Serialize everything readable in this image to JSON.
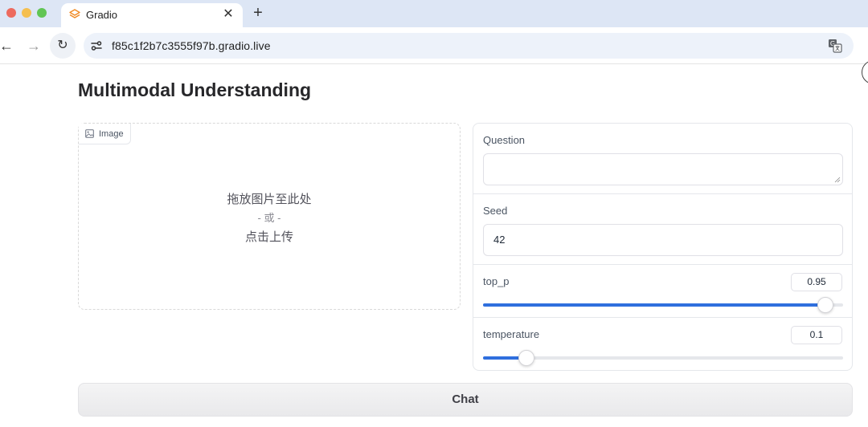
{
  "browser": {
    "tab_title": "Gradio",
    "url": "f85c1f2b7c3555f97b.gradio.live",
    "close_glyph": "✕",
    "new_tab_glyph": "+",
    "back_glyph": "←",
    "forward_glyph": "→",
    "reload_glyph": "↻"
  },
  "page": {
    "title": "Multimodal Understanding"
  },
  "image_upload": {
    "label": "Image",
    "drop_text": "拖放图片至此处",
    "or_text": "- 或 -",
    "click_text": "点击上传"
  },
  "form": {
    "question": {
      "label": "Question",
      "value": ""
    },
    "seed": {
      "label": "Seed",
      "value": "42"
    },
    "top_p": {
      "label": "top_p",
      "value": "0.95",
      "fraction": 0.95
    },
    "temperature": {
      "label": "temperature",
      "value": "0.1",
      "fraction": 0.12
    }
  },
  "actions": {
    "chat_label": "Chat"
  },
  "colors": {
    "accent": "#2f6fde",
    "tabbar": "#dde6f5"
  }
}
